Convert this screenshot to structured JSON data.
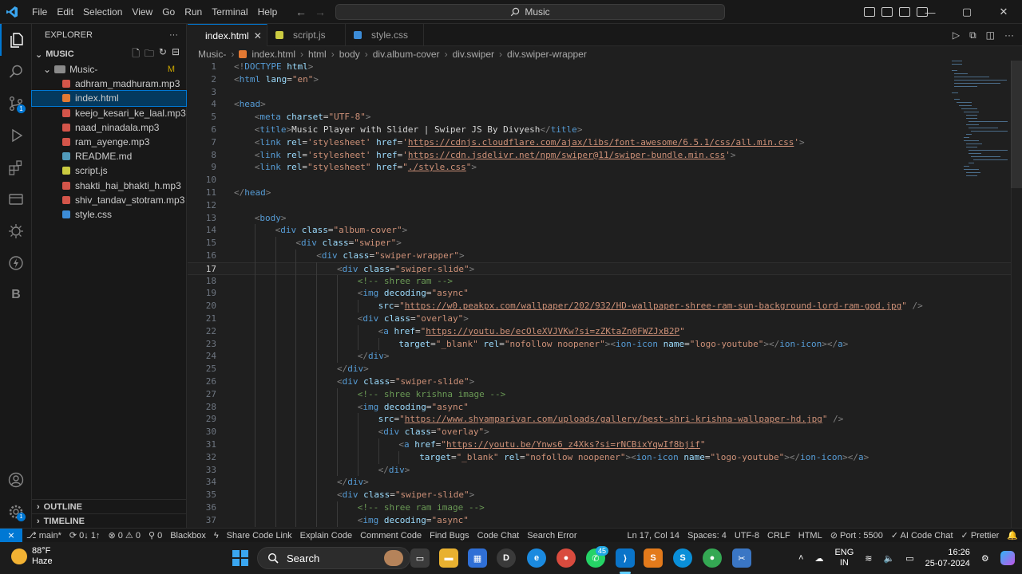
{
  "menu": [
    "File",
    "Edit",
    "Selection",
    "View",
    "Go",
    "Run",
    "Terminal",
    "Help"
  ],
  "search_text": "Music",
  "explorer": {
    "title": "EXPLORER",
    "root": "MUSIC",
    "folder": "Music-",
    "folder_badge": "M",
    "files": [
      {
        "name": "adhram_madhuram.mp3",
        "type": "mp3"
      },
      {
        "name": "index.html",
        "type": "html",
        "selected": true
      },
      {
        "name": "keejo_kesari_ke_laal.mp3",
        "type": "mp3"
      },
      {
        "name": "naad_ninadala.mp3",
        "type": "mp3"
      },
      {
        "name": "ram_ayenge.mp3",
        "type": "mp3"
      },
      {
        "name": "README.md",
        "type": "md"
      },
      {
        "name": "script.js",
        "type": "js"
      },
      {
        "name": "shakti_hai_bhakti_h.mp3",
        "type": "mp3"
      },
      {
        "name": "shiv_tandav_stotram.mp3",
        "type": "mp3"
      },
      {
        "name": "style.css",
        "type": "css"
      }
    ],
    "outline": "OUTLINE",
    "timeline": "TIMELINE"
  },
  "tabs": [
    {
      "label": "index.html",
      "type": "html",
      "active": true
    },
    {
      "label": "script.js",
      "type": "js"
    },
    {
      "label": "style.css",
      "type": "css"
    }
  ],
  "breadcrumb": [
    "Music-",
    "index.html",
    "html",
    "body",
    "div.album-cover",
    "div.swiper",
    "div.swiper-wrapper"
  ],
  "current_line": 17,
  "code_lines": [
    {
      "n": 1,
      "indent": 0,
      "html": "<span class='br'>&lt;!</span><span class='tg'>DOCTYPE</span> <span class='at'>html</span><span class='br'>&gt;</span>"
    },
    {
      "n": 2,
      "indent": 0,
      "html": "<span class='br'>&lt;</span><span class='tg'>html</span> <span class='at'>lang</span>=<span class='st'>\"en\"</span><span class='br'>&gt;</span>"
    },
    {
      "n": 3,
      "indent": 0,
      "html": ""
    },
    {
      "n": 4,
      "indent": 0,
      "html": "<span class='br'>&lt;</span><span class='tg'>head</span><span class='br'>&gt;</span>"
    },
    {
      "n": 5,
      "indent": 1,
      "html": "<span class='br'>&lt;</span><span class='tg'>meta</span> <span class='at'>charset</span>=<span class='st'>\"UTF-8\"</span><span class='br'>&gt;</span>"
    },
    {
      "n": 6,
      "indent": 1,
      "html": "<span class='br'>&lt;</span><span class='tg'>title</span><span class='br'>&gt;</span><span class='tx'>Music Player with Slider | Swiper JS By Divyesh</span><span class='br'>&lt;/</span><span class='tg'>title</span><span class='br'>&gt;</span>"
    },
    {
      "n": 7,
      "indent": 1,
      "html": "<span class='br'>&lt;</span><span class='tg'>link</span> <span class='at'>rel</span>=<span class='st'>'stylesheet'</span> <span class='at'>href</span>=<span class='st'>'</span><span class='lk'>https://cdnjs.cloudflare.com/ajax/libs/font-awesome/6.5.1/css/all.min.css</span><span class='st'>'</span><span class='br'>&gt;</span>"
    },
    {
      "n": 8,
      "indent": 1,
      "html": "<span class='br'>&lt;</span><span class='tg'>link</span> <span class='at'>rel</span>=<span class='st'>'stylesheet'</span> <span class='at'>href</span>=<span class='st'>'</span><span class='lk'>https://cdn.jsdelivr.net/npm/swiper@11/swiper-bundle.min.css</span><span class='st'>'</span><span class='br'>&gt;</span>"
    },
    {
      "n": 9,
      "indent": 1,
      "html": "<span class='br'>&lt;</span><span class='tg'>link</span> <span class='at'>rel</span>=<span class='st'>\"stylesheet\"</span> <span class='at'>href</span>=<span class='st'>\"</span><span class='lk'>./style.css</span><span class='st'>\"</span><span class='br'>&gt;</span>"
    },
    {
      "n": 10,
      "indent": 0,
      "html": ""
    },
    {
      "n": 11,
      "indent": 0,
      "html": "<span class='br'>&lt;/</span><span class='tg'>head</span><span class='br'>&gt;</span>"
    },
    {
      "n": 12,
      "indent": 0,
      "html": ""
    },
    {
      "n": 13,
      "indent": 1,
      "html": "<span class='br'>&lt;</span><span class='tg'>body</span><span class='br'>&gt;</span>"
    },
    {
      "n": 14,
      "indent": 2,
      "html": "<span class='br'>&lt;</span><span class='tg'>div</span> <span class='at'>class</span>=<span class='st'>\"album-cover\"</span><span class='br'>&gt;</span>"
    },
    {
      "n": 15,
      "indent": 3,
      "html": "<span class='br'>&lt;</span><span class='tg'>div</span> <span class='at'>class</span>=<span class='st'>\"swiper\"</span><span class='br'>&gt;</span>"
    },
    {
      "n": 16,
      "indent": 4,
      "html": "<span class='br'>&lt;</span><span class='tg'>div</span> <span class='at'>class</span>=<span class='st'>\"swiper-wrapper\"</span><span class='br'>&gt;</span>"
    },
    {
      "n": 17,
      "indent": 5,
      "html": "<span class='br'>&lt;</span><span class='tg'>div</span> <span class='at'>class</span>=<span class='st'>\"swiper-slide\"</span><span class='br'>&gt;</span>"
    },
    {
      "n": 18,
      "indent": 6,
      "html": "<span class='cm'>&lt;!-- shree ram --&gt;</span>"
    },
    {
      "n": 19,
      "indent": 6,
      "html": "<span class='br'>&lt;</span><span class='tg'>img</span> <span class='at'>decoding</span>=<span class='st'>\"async\"</span>"
    },
    {
      "n": 20,
      "indent": 7,
      "html": "<span class='at'>src</span>=<span class='st'>\"</span><span class='lk'>https://w0.peakpx.com/wallpaper/202/932/HD-wallpaper-shree-ram-sun-background-lord-ram-god.jpg</span><span class='st'>\"</span> <span class='br'>/&gt;</span>"
    },
    {
      "n": 21,
      "indent": 6,
      "html": "<span class='br'>&lt;</span><span class='tg'>div</span> <span class='at'>class</span>=<span class='st'>\"overlay\"</span><span class='br'>&gt;</span>"
    },
    {
      "n": 22,
      "indent": 7,
      "html": "<span class='br'>&lt;</span><span class='tg'>a</span> <span class='at'>href</span>=<span class='st'>\"</span><span class='lk'>https://youtu.be/ecOleXVJVKw?si=zZKtaZn0FWZJxB2P</span><span class='st'>\"</span>"
    },
    {
      "n": 23,
      "indent": 8,
      "html": "<span class='at'>target</span>=<span class='st'>\"_blank\"</span> <span class='at'>rel</span>=<span class='st'>\"nofollow noopener\"</span><span class='br'>&gt;&lt;</span><span class='tg'>ion-icon</span> <span class='at'>name</span>=<span class='st'>\"logo-youtube\"</span><span class='br'>&gt;&lt;/</span><span class='tg'>ion-icon</span><span class='br'>&gt;&lt;/</span><span class='tg'>a</span><span class='br'>&gt;</span>"
    },
    {
      "n": 24,
      "indent": 6,
      "html": "<span class='br'>&lt;/</span><span class='tg'>div</span><span class='br'>&gt;</span>"
    },
    {
      "n": 25,
      "indent": 5,
      "html": "<span class='br'>&lt;/</span><span class='tg'>div</span><span class='br'>&gt;</span>"
    },
    {
      "n": 26,
      "indent": 5,
      "html": "<span class='br'>&lt;</span><span class='tg'>div</span> <span class='at'>class</span>=<span class='st'>\"swiper-slide\"</span><span class='br'>&gt;</span>"
    },
    {
      "n": 27,
      "indent": 6,
      "html": "<span class='cm'>&lt;!-- shree krishna image --&gt;</span>"
    },
    {
      "n": 28,
      "indent": 6,
      "html": "<span class='br'>&lt;</span><span class='tg'>img</span> <span class='at'>decoding</span>=<span class='st'>\"async\"</span>"
    },
    {
      "n": 29,
      "indent": 7,
      "html": "<span class='at'>src</span>=<span class='st'>\"</span><span class='lk'>https://www.shyamparivar.com/uploads/gallery/best-shri-krishna-wallpaper-hd.jpg</span><span class='st'>\"</span> <span class='br'>/&gt;</span>"
    },
    {
      "n": 30,
      "indent": 7,
      "html": "<span class='br'>&lt;</span><span class='tg'>div</span> <span class='at'>class</span>=<span class='st'>\"overlay\"</span><span class='br'>&gt;</span>"
    },
    {
      "n": 31,
      "indent": 8,
      "html": "<span class='br'>&lt;</span><span class='tg'>a</span> <span class='at'>href</span>=<span class='st'>\"</span><span class='lk'>https://youtu.be/Ynws6_z4Xks?si=rNCBixYqwIf8bjif</span><span class='st'>\"</span>"
    },
    {
      "n": 32,
      "indent": 9,
      "html": "<span class='at'>target</span>=<span class='st'>\"_blank\"</span> <span class='at'>rel</span>=<span class='st'>\"nofollow noopener\"</span><span class='br'>&gt;&lt;</span><span class='tg'>ion-icon</span> <span class='at'>name</span>=<span class='st'>\"logo-youtube\"</span><span class='br'>&gt;&lt;/</span><span class='tg'>ion-icon</span><span class='br'>&gt;&lt;/</span><span class='tg'>a</span><span class='br'>&gt;</span>"
    },
    {
      "n": 33,
      "indent": 7,
      "html": "<span class='br'>&lt;/</span><span class='tg'>div</span><span class='br'>&gt;</span>"
    },
    {
      "n": 34,
      "indent": 5,
      "html": "<span class='br'>&lt;/</span><span class='tg'>div</span><span class='br'>&gt;</span>"
    },
    {
      "n": 35,
      "indent": 5,
      "html": "<span class='br'>&lt;</span><span class='tg'>div</span> <span class='at'>class</span>=<span class='st'>\"swiper-slide\"</span><span class='br'>&gt;</span>"
    },
    {
      "n": 36,
      "indent": 6,
      "html": "<span class='cm'>&lt;!-- shree ram image --&gt;</span>"
    },
    {
      "n": 37,
      "indent": 6,
      "html": "<span class='br'>&lt;</span><span class='tg'>img</span> <span class='at'>decoding</span>=<span class='st'>\"async\"</span>"
    }
  ],
  "status": {
    "branch": "main*",
    "sync": "0 1↓ 0 1↑",
    "sync_text": "0↓ 1↑",
    "errors": "0",
    "warnings": "0",
    "ports_count": "0",
    "items_left": [
      "Blackbox",
      "Share Code Link",
      "Explain Code",
      "Comment Code",
      "Find Bugs",
      "Code Chat",
      "Search Error"
    ],
    "position": "Ln 17, Col 14",
    "spaces": "Spaces: 4",
    "encoding": "UTF-8",
    "eol": "CRLF",
    "language": "HTML",
    "port": "Port : 5500",
    "ai_chat": "AI Code Chat",
    "prettier": "Prettier"
  },
  "taskbar": {
    "temp": "88°F",
    "weather": "Haze",
    "search_label": "Search",
    "lang_top": "ENG",
    "lang_bottom": "IN",
    "time": "16:26",
    "date": "25-07-2024",
    "whatsapp_badge": "45"
  },
  "colors": {
    "accent": "#0078d4",
    "editor_bg": "#1f1f1f",
    "chrome_bg": "#181818"
  }
}
